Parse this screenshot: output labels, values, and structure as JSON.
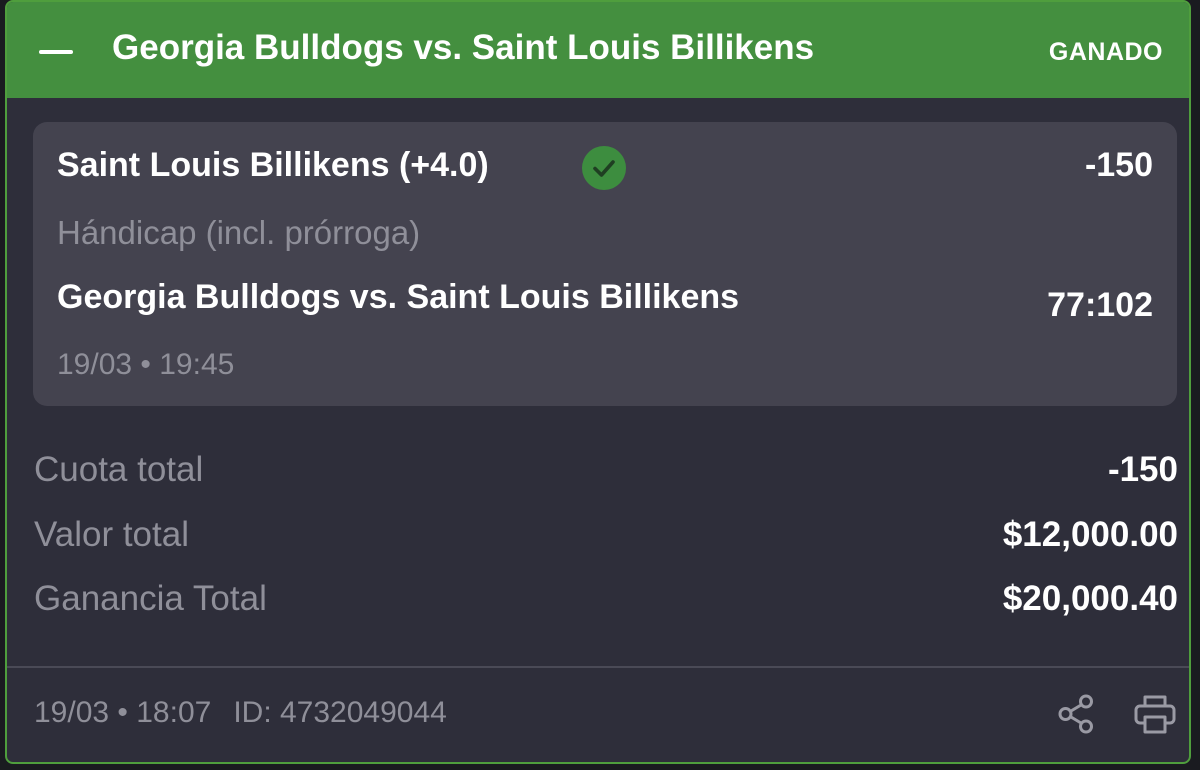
{
  "header": {
    "title": "Georgia Bulldogs vs. Saint Louis Billikens",
    "status": "GANADO",
    "collapse_icon": "minus-icon"
  },
  "selection": {
    "name": "Saint Louis Billikens (+4.0)",
    "status_icon": "check-circle-icon",
    "odds": "-150",
    "market": "Hándicap (incl. prórroga)",
    "event": "Georgia Bulldogs vs. Saint Louis Billikens",
    "score": "77:102",
    "datetime": "19/03 • 19:45"
  },
  "summary": {
    "total_odds_label": "Cuota total",
    "total_odds_value": "-150",
    "total_stake_label": "Valor total",
    "total_stake_value": "$12,000.00",
    "total_payout_label": "Ganancia Total",
    "total_payout_value": "$20,000.40"
  },
  "footer": {
    "datetime": "19/03 • 18:07",
    "bet_id": "ID: 4732049044",
    "share_icon": "share-icon",
    "print_icon": "print-icon"
  },
  "colors": {
    "accent_green": "#448f3f",
    "border_green": "#4f9e3d",
    "card_bg": "#2e2e3a",
    "selection_bg": "#44434f",
    "muted_text": "#8f8f99"
  }
}
